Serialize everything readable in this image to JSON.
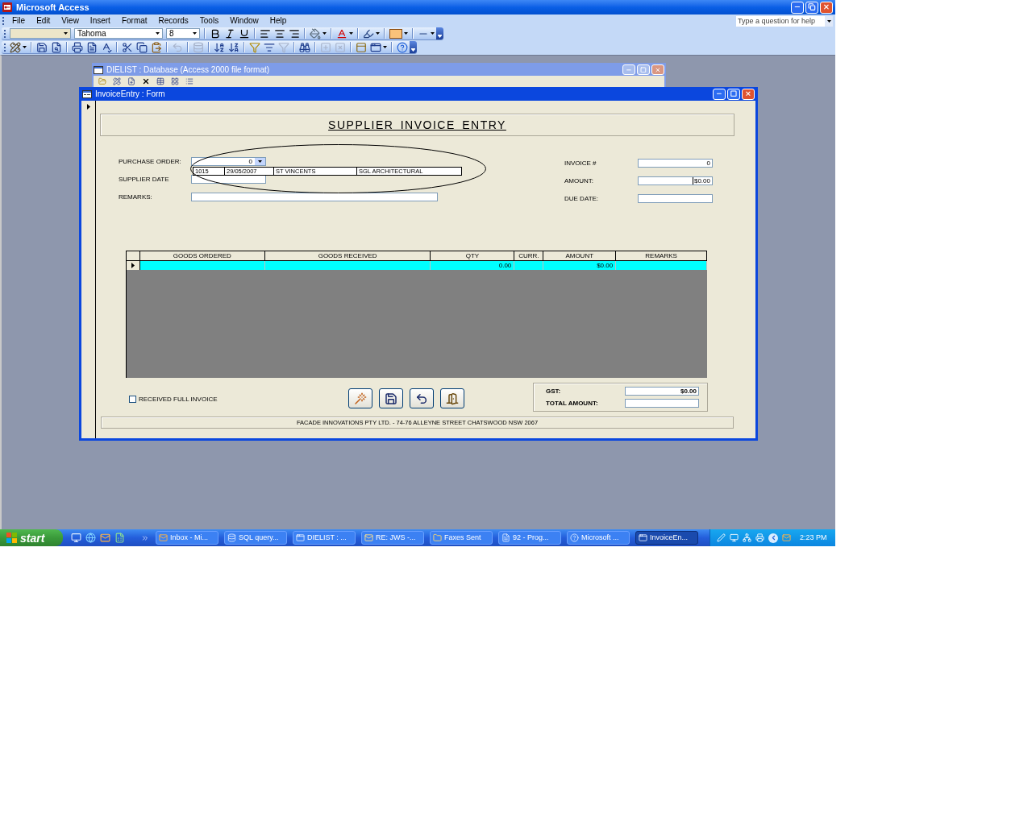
{
  "app_window": {
    "title": "Microsoft Access"
  },
  "menu_bar": {
    "items": [
      "File",
      "Edit",
      "View",
      "Insert",
      "Format",
      "Records",
      "Tools",
      "Window",
      "Help"
    ],
    "help_box": {
      "placeholder": "Type a question for help"
    }
  },
  "formatting_toolbar": {
    "font": "Tahoma",
    "font_size": "8"
  },
  "database_window": {
    "title": "DIELIST : Database (Access 2000 file format)"
  },
  "form_window": {
    "title": "InvoiceEntry : Form",
    "heading": "SUPPLIER INVOICE ENTRY",
    "left_fields": [
      {
        "kind": "combo",
        "label": "PURCHASE ORDER:",
        "value": "0"
      },
      {
        "kind": "text",
        "label": "SUPPLIER DATE"
      },
      {
        "kind": "text",
        "label": "REMARKS:"
      }
    ],
    "combo_dropdown": {
      "rows": [
        {
          "cells": [
            "1015",
            "29/05/2007",
            "ST VINCENTS",
            "SGL ARCHITECTURAL"
          ]
        }
      ]
    },
    "right_fields": [
      {
        "label": "INVOICE #",
        "value": "0",
        "focused": false
      },
      {
        "label": "AMOUNT:",
        "value": "$0.00",
        "focused": true
      },
      {
        "label": "DUE DATE:",
        "focused": false
      }
    ],
    "grid": {
      "columns": [
        "GOODS ORDERED",
        "GOODS RECEIVED",
        "QTY",
        "CURR.",
        "AMOUNT",
        "REMARKS"
      ],
      "rows": [
        {
          "selected": true,
          "qty": "0.00",
          "amount": "$0.00"
        }
      ]
    },
    "received_full_invoice": {
      "label": "RECEIVED FULL INVOICE",
      "checked": false
    },
    "totals": [
      {
        "label": "GST:",
        "value": "$0.00"
      },
      {
        "label": "TOTAL AMOUNT:"
      }
    ],
    "footer": "FACADE INNOVATIONS PTY LTD. - 74-76 ALLEYNE STREET  CHATSWOOD NSW 2067"
  },
  "taskbar": {
    "start": "start",
    "tasks": [
      {
        "label": "Inbox - Mi...",
        "selected": false
      },
      {
        "label": "SQL query...",
        "selected": false
      },
      {
        "label": "DIELIST : ...",
        "selected": false
      },
      {
        "label": "RE: JWS -...",
        "selected": false
      },
      {
        "label": "Faxes Sent",
        "selected": false
      },
      {
        "label": "92 - Prog...",
        "selected": false
      },
      {
        "label": "Microsoft ...",
        "selected": false
      },
      {
        "label": "InvoiceEn...",
        "selected": true
      }
    ],
    "clock": "2:23 PM"
  }
}
